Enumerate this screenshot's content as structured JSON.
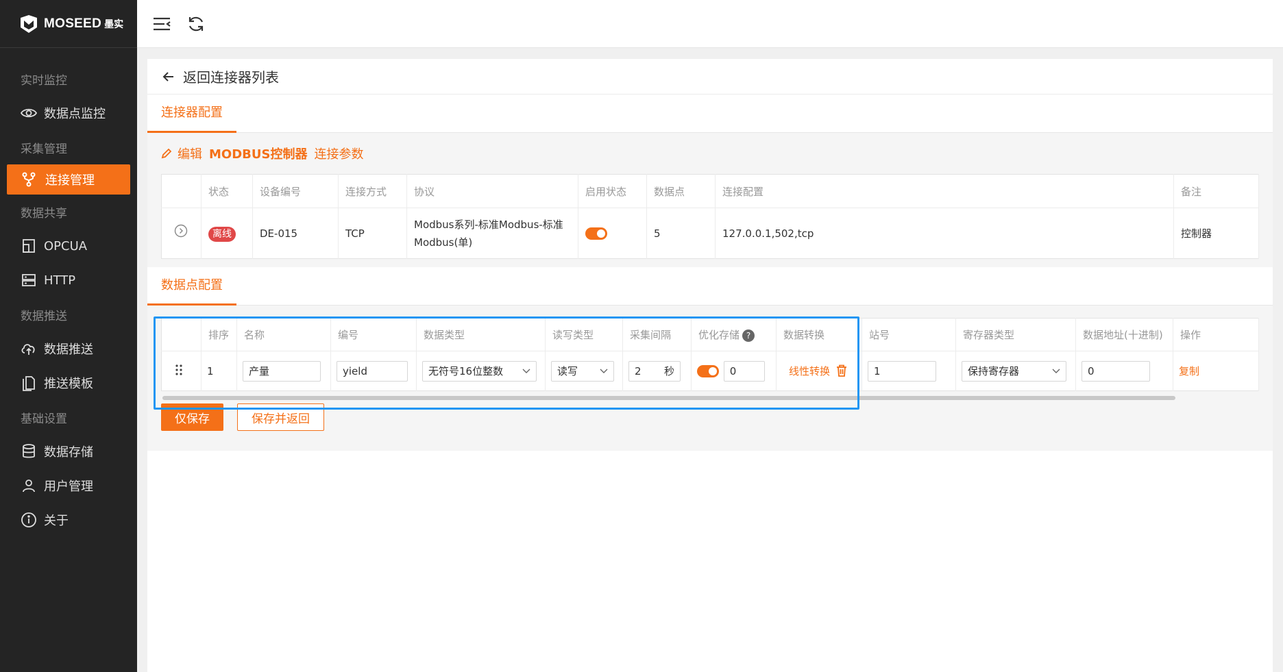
{
  "brand": {
    "name": "MOSEED",
    "sub": "墨实"
  },
  "sidebar": {
    "groups": [
      {
        "label": "实时监控",
        "items": [
          {
            "label": "数据点监控",
            "icon": "eye-icon"
          }
        ]
      },
      {
        "label": "采集管理",
        "items": [
          {
            "label": "连接管理",
            "icon": "branch-icon",
            "active": true
          }
        ]
      },
      {
        "label": "数据共享",
        "items": [
          {
            "label": "OPCUA",
            "icon": "opcua-icon"
          },
          {
            "label": "HTTP",
            "icon": "server-icon"
          }
        ]
      },
      {
        "label": "数据推送",
        "items": [
          {
            "label": "数据推送",
            "icon": "upload-icon"
          },
          {
            "label": "推送模板",
            "icon": "template-icon"
          }
        ]
      },
      {
        "label": "基础设置",
        "items": [
          {
            "label": "数据存储",
            "icon": "database-icon"
          },
          {
            "label": "用户管理",
            "icon": "user-icon"
          },
          {
            "label": "关于",
            "icon": "info-icon"
          }
        ]
      }
    ]
  },
  "header": {
    "back_label": "返回连接器列表"
  },
  "tabs": {
    "connector": "连接器配置",
    "datapoint": "数据点配置"
  },
  "connector_panel": {
    "title_prefix": "编辑",
    "title_name": "MODBUS控制器",
    "title_suffix": "连接参数",
    "columns": [
      "状态",
      "设备编号",
      "连接方式",
      "协议",
      "启用状态",
      "数据点",
      "连接配置",
      "备注"
    ],
    "row": {
      "status": "离线",
      "device_id": "DE-015",
      "conn_type": "TCP",
      "protocol": "Modbus系列-标准Modbus-标准Modbus(单)",
      "enabled": true,
      "points": "5",
      "config": "127.0.0.1,502,tcp",
      "remark": "控制器"
    }
  },
  "datapoint_panel": {
    "columns": [
      "排序",
      "名称",
      "编号",
      "数据类型",
      "读写类型",
      "采集间隔",
      "优化存储",
      "数据转换",
      "站号",
      "寄存器类型",
      "数据地址(十进制)",
      "操作"
    ],
    "help_mark": "?",
    "row": {
      "order": "1",
      "name": "产量",
      "code": "yield",
      "data_type": "无符号16位整数",
      "rw_type": "读写",
      "interval": "2",
      "interval_unit": "秒",
      "optimize_enabled": true,
      "optimize_value": "0",
      "convert_label": "线性转换",
      "station": "1",
      "register_type": "保持寄存器",
      "address": "0",
      "action": "复制"
    }
  },
  "buttons": {
    "save_only": "仅保存",
    "save_back": "保存并返回"
  },
  "colors": {
    "accent": "#f47018",
    "sidebar_bg": "#242424",
    "highlight": "#2196f3",
    "offline": "#e04848"
  }
}
